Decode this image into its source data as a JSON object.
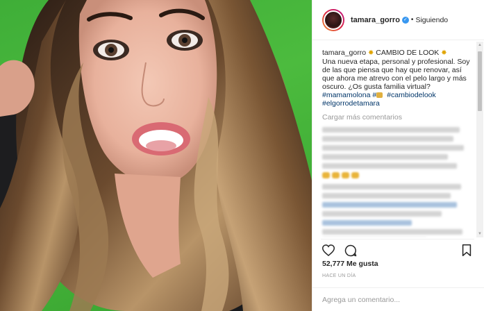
{
  "header": {
    "username": "tamara_gorro",
    "separator": "•",
    "follow_status": "Siguiendo",
    "verified_icon": "verified-badge-icon"
  },
  "caption": {
    "username": "tamara_gorro",
    "text_line1": "CAMBIO DE LOOK",
    "body": "Una nueva etapa, personal y profesional. Soy de las que piensa que hay que renovar, así que ahora me atrevo con el pelo largo y más oscuro. ¿Os gusta familia virtual?",
    "hashtag1": "#mamamolona",
    "hashtag2": "#",
    "hashtag3": "#cambiodelook",
    "hashtag4": "#elgorrodetamara"
  },
  "load_more": "Cargar más comentarios",
  "likes": "52,777 Me gusta",
  "time": "HACE UN DÍA",
  "add_comment": {
    "placeholder": "Agrega un comentario..."
  },
  "colors": {
    "hashtag": "#003569",
    "muted": "#999999",
    "verified": "#3897f0",
    "green_screen": "#3fae38"
  },
  "icons": [
    "heart-icon",
    "comment-icon",
    "bookmark-icon",
    "sparkle-icon"
  ]
}
